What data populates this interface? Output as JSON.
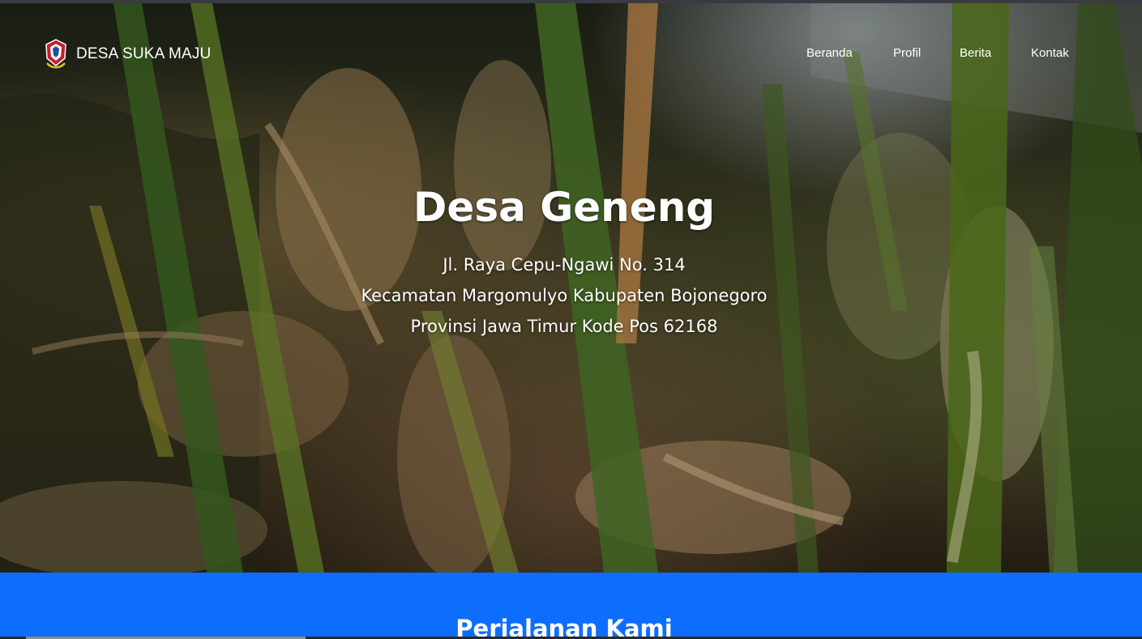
{
  "navbar": {
    "brand": "DESA SUKA MAJU",
    "logo_icon": "village-emblem-icon",
    "links": [
      "Beranda",
      "Profil",
      "Berita",
      "Kontak"
    ]
  },
  "hero": {
    "title": "Desa Geneng",
    "address_line1": "Jl. Raya Cepu-Ngawi No. 314",
    "address_line2": "Kecamatan Margomulyo Kabupaten Bojonegoro",
    "address_line3": "Provinsi Jawa Timur Kode Pos 62168",
    "background": "rice-field-photo"
  },
  "section": {
    "title": "Perjalanan Kami",
    "background_color": "#0d6efd"
  }
}
